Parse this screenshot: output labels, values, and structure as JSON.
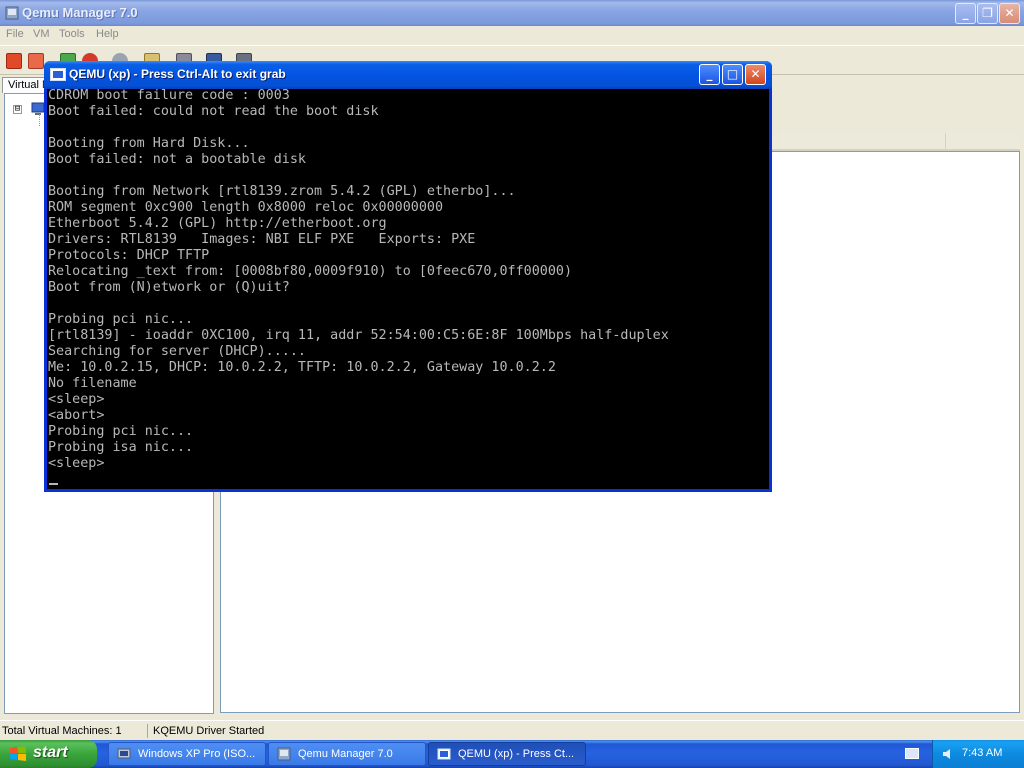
{
  "manager": {
    "title": "Qemu Manager 7.0",
    "menu": [
      "File",
      "VM",
      "Tools",
      "Help"
    ],
    "tab_label": "Virtual M",
    "tree_expander": "⊟",
    "status_count": "Total Virtual Machines: 1",
    "status_driver": "KQEMU Driver Started"
  },
  "qemu_window": {
    "title": "QEMU (xp) - Press Ctrl-Alt to exit grab",
    "console_lines": [
      "CDROM boot failure code : 0003",
      "Boot failed: could not read the boot disk",
      "",
      "Booting from Hard Disk...",
      "Boot failed: not a bootable disk",
      "",
      "Booting from Network [rtl8139.zrom 5.4.2 (GPL) etherbo]...",
      "ROM segment 0xc900 length 0x8000 reloc 0x00000000",
      "Etherboot 5.4.2 (GPL) http://etherboot.org",
      "Drivers: RTL8139   Images: NBI ELF PXE   Exports: PXE",
      "Protocols: DHCP TFTP",
      "Relocating _text from: [0008bf80,0009f910) to [0feec670,0ff00000)",
      "Boot from (N)etwork or (Q)uit?",
      "",
      "Probing pci nic...",
      "[rtl8139] - ioaddr 0XC100, irq 11, addr 52:54:00:C5:6E:8F 100Mbps half-duplex",
      "Searching for server (DHCP).....",
      "Me: 10.0.2.15, DHCP: 10.0.2.2, TFTP: 10.0.2.2, Gateway 10.0.2.2",
      "No filename",
      "<sleep>",
      "<abort>",
      "Probing pci nic...",
      "Probing isa nic...",
      "<sleep>"
    ]
  },
  "taskbar": {
    "start_label": "start",
    "tasks": [
      {
        "label": "Windows XP Pro (ISO..."
      },
      {
        "label": "Qemu Manager 7.0"
      },
      {
        "label": "QEMU (xp) - Press Ct..."
      }
    ],
    "clock": "7:43 AM"
  }
}
